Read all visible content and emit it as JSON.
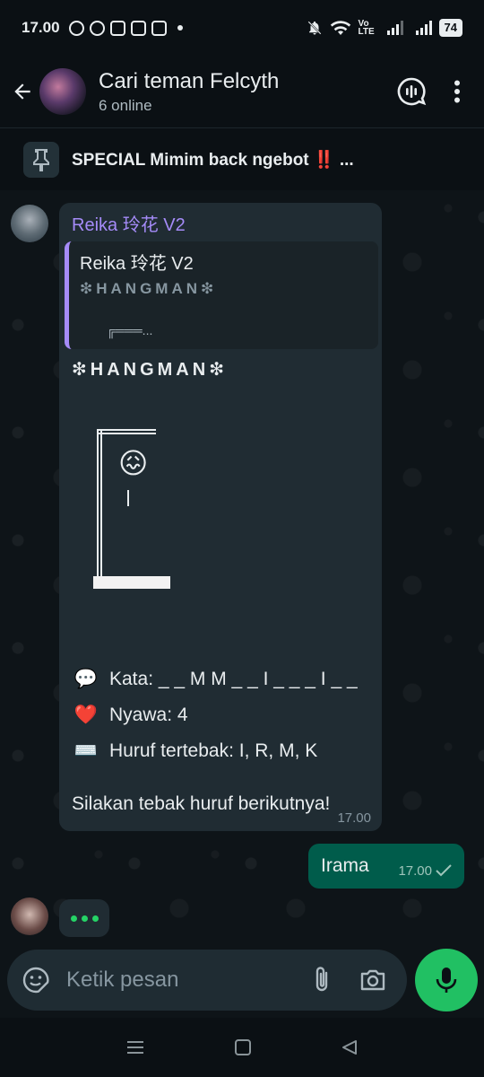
{
  "status_bar": {
    "time": "17.00",
    "network_label": "Vo LTE",
    "battery": "74"
  },
  "header": {
    "title": "Cari teman Felcyth",
    "subtitle": "6 online"
  },
  "pinned": {
    "text": "SPECIAL Mimim back ngebot",
    "emoji": "‼️",
    "ellipsis": "..."
  },
  "incoming": {
    "sender": "Reika 玲花 V2",
    "quote": {
      "author": "Reika 玲花 V2",
      "text": "❇HANGMAN❇",
      "snippet": "╔═══..."
    },
    "title": "❇HANGMAN❇",
    "face_emoji": "😖",
    "lines": [
      {
        "icon": "💬",
        "text": "Kata: _ _ M M _ _ I _ _ _ I _ _"
      },
      {
        "icon": "❤️",
        "text": "Nyawa: 4"
      },
      {
        "icon": "⌨️",
        "text": "Huruf tertebak: I, R, M, K"
      }
    ],
    "prompt": "Silakan tebak huruf berikutnya!",
    "time": "17.00"
  },
  "outgoing": {
    "text": "Irama",
    "time": "17.00"
  },
  "composer": {
    "placeholder": "Ketik pesan"
  }
}
